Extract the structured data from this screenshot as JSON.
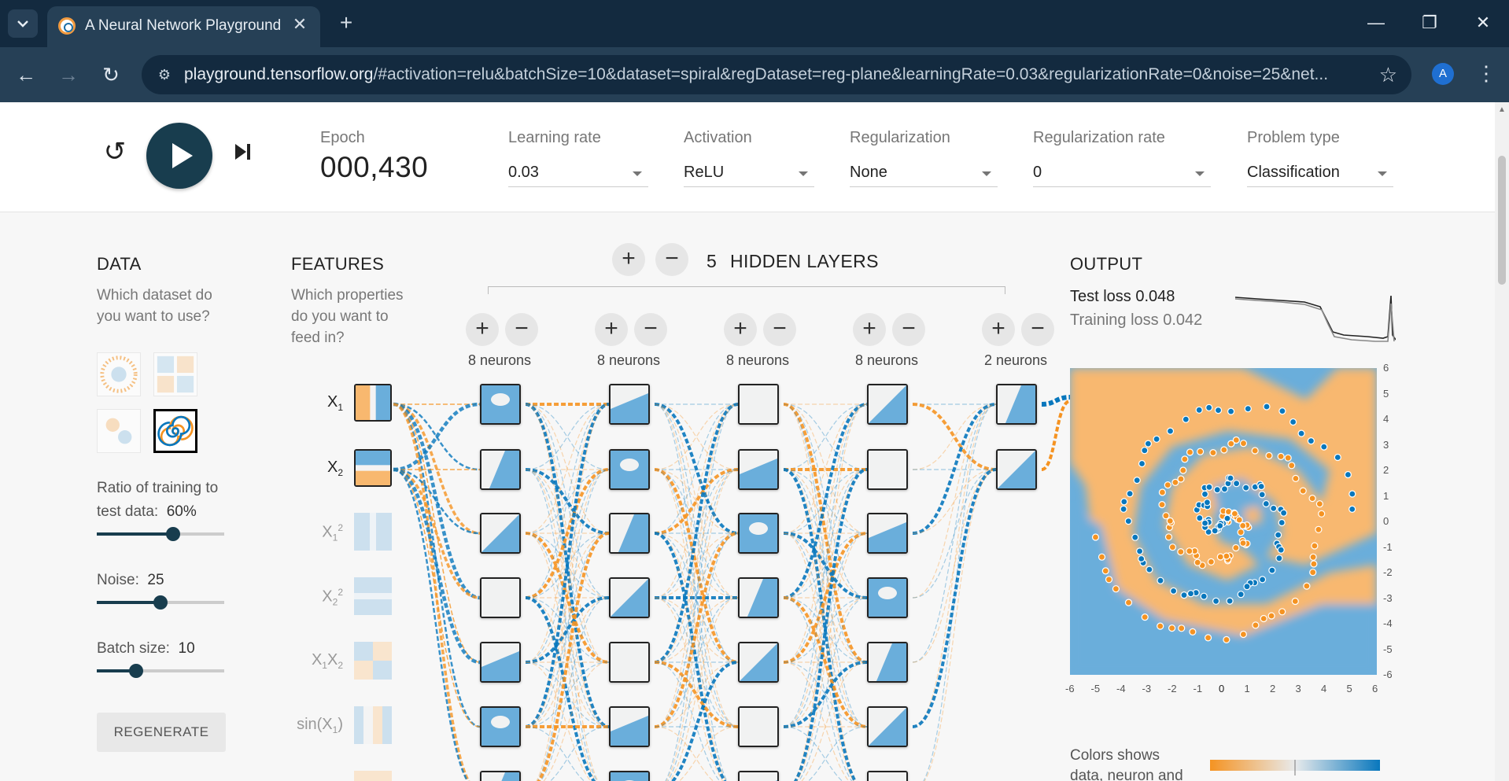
{
  "browser": {
    "tab_title": "A Neural Network Playground",
    "url_host": "playground.tensorflow.org",
    "url_path": "/#activation=relu&batchSize=10&dataset=spiral&regDataset=reg-plane&learningRate=0.03&regularizationRate=0&noise=25&net...",
    "avatar_letter": "A"
  },
  "controls": {
    "epoch_label": "Epoch",
    "epoch_value": "000,430",
    "learning_rate": {
      "label": "Learning rate",
      "value": "0.03"
    },
    "activation": {
      "label": "Activation",
      "value": "ReLU"
    },
    "regularization": {
      "label": "Regularization",
      "value": "None"
    },
    "regularization_rate": {
      "label": "Regularization rate",
      "value": "0"
    },
    "problem_type": {
      "label": "Problem type",
      "value": "Classification"
    }
  },
  "data_panel": {
    "title": "DATA",
    "subtitle_1": "Which dataset do",
    "subtitle_2": "you want to use?",
    "ratio": {
      "label": "Ratio of training to",
      "label2": "test data:",
      "value": "60%",
      "fraction": 0.6
    },
    "noise": {
      "label": "Noise:",
      "value": "25",
      "fraction": 0.5
    },
    "batch": {
      "label": "Batch size:",
      "value": "10",
      "fraction": 0.31
    },
    "regenerate": "REGENERATE"
  },
  "features_panel": {
    "title": "FEATURES",
    "subtitle_1": "Which properties",
    "subtitle_2": "do you want to",
    "subtitle_3": "feed in?",
    "features": [
      {
        "base": "X",
        "sub": "1",
        "sup": "",
        "base2": "",
        "sub2": "",
        "active": true
      },
      {
        "base": "X",
        "sub": "2",
        "sup": "",
        "base2": "",
        "sub2": "",
        "active": true
      },
      {
        "base": "X",
        "sub": "1",
        "sup": "2",
        "base2": "",
        "sub2": "",
        "active": false
      },
      {
        "base": "X",
        "sub": "2",
        "sup": "2",
        "base2": "",
        "sub2": "",
        "active": false
      },
      {
        "base": "X",
        "sub": "1",
        "sup": "",
        "base2": "X",
        "sub2": "2",
        "active": false
      },
      {
        "base": "sin(X",
        "sub": "1",
        "sup": "",
        "base2": ")",
        "sub2": "",
        "active": false
      }
    ]
  },
  "network": {
    "hidden_count": "5",
    "hidden_title": "HIDDEN LAYERS",
    "layers": [
      {
        "label": "8 neurons"
      },
      {
        "label": "8 neurons"
      },
      {
        "label": "8 neurons"
      },
      {
        "label": "8 neurons"
      },
      {
        "label": "2 neurons"
      }
    ]
  },
  "output_panel": {
    "title": "OUTPUT",
    "test_loss_label": "Test loss",
    "test_loss_value": "0.048",
    "train_loss_label": "Training loss",
    "train_loss_value": "0.042",
    "axis_ticks": [
      "-6",
      "-5",
      "-4",
      "-3",
      "-2",
      "-1",
      "0",
      "1",
      "2",
      "3",
      "4",
      "5",
      "6"
    ],
    "legend_1": "Colors shows",
    "legend_2": "data, neuron and"
  },
  "colors": {
    "orange": "#f59322",
    "blue": "#0877bd",
    "dark": "#183d4e"
  },
  "icons": [
    "chevron-down-icon",
    "close-icon",
    "plus-icon",
    "minimize-icon",
    "restore-icon",
    "back-icon",
    "forward-icon",
    "reload-icon",
    "site-info-icon",
    "star-icon",
    "kebab-icon",
    "reset-icon",
    "play-icon",
    "step-icon"
  ]
}
